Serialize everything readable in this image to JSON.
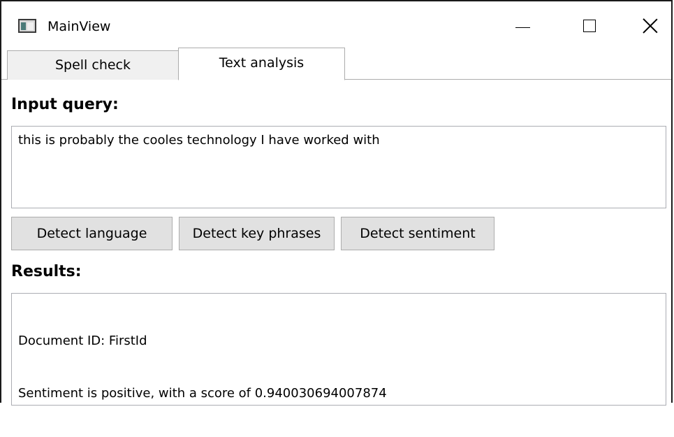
{
  "window": {
    "title": "MainView",
    "icon": "app-window-icon"
  },
  "tabs": [
    {
      "label": "Spell check",
      "selected": false
    },
    {
      "label": "Text analysis",
      "selected": true
    }
  ],
  "input": {
    "heading": "Input query:",
    "value": "this is probably the cooles technology I have worked with"
  },
  "buttons": {
    "detect_language": "Detect language",
    "detect_key_phrases": "Detect key phrases",
    "detect_sentiment": "Detect sentiment"
  },
  "results": {
    "heading": "Results:",
    "lines": [
      "Document ID: FirstId",
      "Sentiment is positive, with a score of 0.940030694007874"
    ]
  },
  "colors": {
    "button_face": "#e1e1e1",
    "inactive_tab": "#f0f0f0",
    "border": "#acacac"
  }
}
